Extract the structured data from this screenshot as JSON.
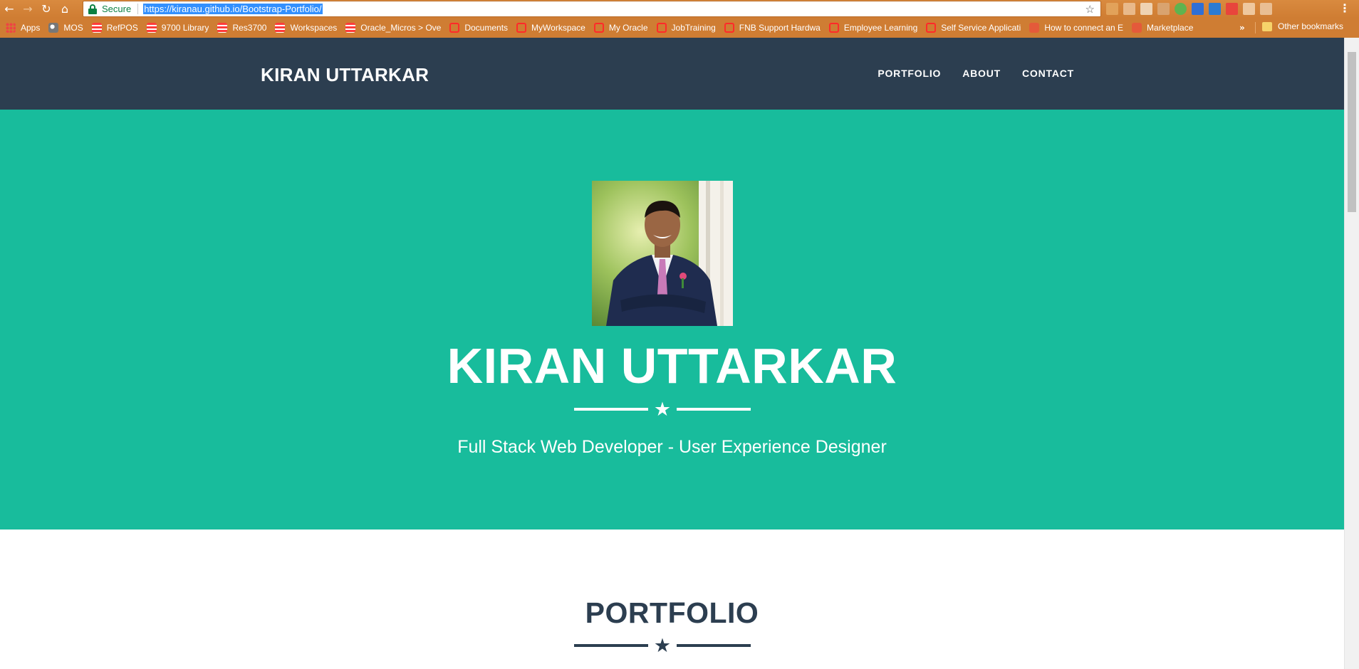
{
  "browser": {
    "secure_label": "Secure",
    "url": "https://kiranau.github.io/Bootstrap-Portfolio/",
    "bookmarks": [
      {
        "label": "Apps",
        "icon": "apps-grid-icon"
      },
      {
        "label": "MOS",
        "icon": "globe-icon"
      },
      {
        "label": "RefPOS",
        "icon": "stack-icon"
      },
      {
        "label": "9700 Library",
        "icon": "stack-icon"
      },
      {
        "label": "Res3700",
        "icon": "stack-icon"
      },
      {
        "label": "Workspaces",
        "icon": "stack-icon"
      },
      {
        "label": "Oracle_Micros > Ove",
        "icon": "stack-icon"
      },
      {
        "label": "Documents",
        "icon": "oracle-icon"
      },
      {
        "label": "MyWorkspace",
        "icon": "oracle-icon"
      },
      {
        "label": "My Oracle",
        "icon": "oracle-icon"
      },
      {
        "label": "JobTraining",
        "icon": "oracle-icon"
      },
      {
        "label": "FNB Support Hardwa",
        "icon": "oracle-icon"
      },
      {
        "label": "Employee Learning",
        "icon": "oracle-icon"
      },
      {
        "label": "Self Service Applicati",
        "icon": "oracle-icon"
      },
      {
        "label": "How to connect an E",
        "icon": "gift-icon"
      },
      {
        "label": "Marketplace",
        "icon": "gift-icon"
      }
    ],
    "more_label": "»",
    "other_bookmarks": "Other bookmarks"
  },
  "navbar": {
    "brand": "KIRAN UTTARKAR",
    "links": [
      "PORTFOLIO",
      "ABOUT",
      "CONTACT"
    ]
  },
  "hero": {
    "name": "KIRAN UTTARKAR",
    "tagline": "Full Stack Web Developer - User Experience Designer"
  },
  "portfolio": {
    "heading": "PORTFOLIO"
  },
  "colors": {
    "navbar_bg": "#2c3e50",
    "hero_bg": "#18bc9c",
    "chrome_bg": "#cf7d33"
  }
}
